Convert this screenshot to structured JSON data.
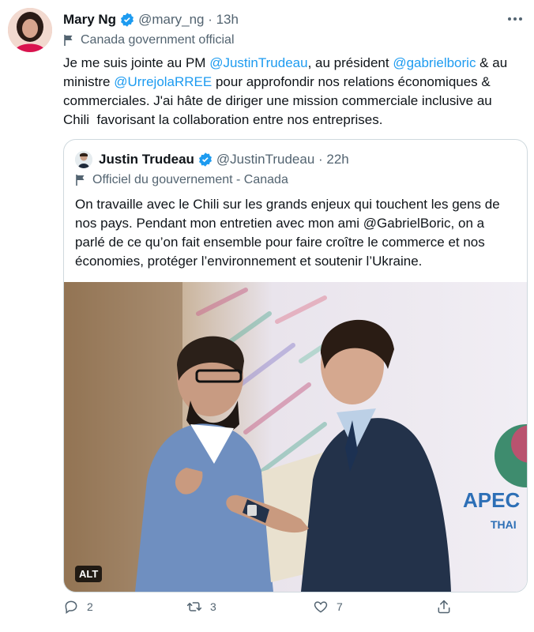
{
  "author": {
    "name": "Mary Ng",
    "handle": "@mary_ng",
    "time": "13h",
    "label": "Canada government official"
  },
  "tweet_text": {
    "p1": "Je me suis jointe au PM ",
    "m1": "@JustinTrudeau",
    "p2": ", au président ",
    "m2": "@gabrielboric",
    "p3": " & au ministre ",
    "m3": "@UrrejolaRREE",
    "p4": " pour approfondir nos relations économiques & commerciales. J'ai hâte de diriger une mission commerciale inclusive au Chili  favorisant la collaboration entre nos entreprises."
  },
  "quoted": {
    "name": "Justin Trudeau",
    "handle": "@JustinTrudeau",
    "time": "22h",
    "label": "Officiel du gouvernement - Canada",
    "text": "On travaille avec le Chili sur les grands enjeux qui touchent les gens de nos pays. Pendant mon entretien avec mon ami @GabrielBoric, on a parlé de ce qu’on fait ensemble pour faire croître le commerce et nos économies, protéger l’environnement et soutenir l’Ukraine.",
    "image": {
      "alt_badge": "ALT",
      "sign_text": "APEC",
      "sign_sub": "THAI"
    }
  },
  "actions": {
    "replies": "2",
    "retweets": "3",
    "likes": "7"
  },
  "colors": {
    "accent": "#1d9bf0",
    "secondary_text": "#536471",
    "border": "#cfd9de"
  }
}
